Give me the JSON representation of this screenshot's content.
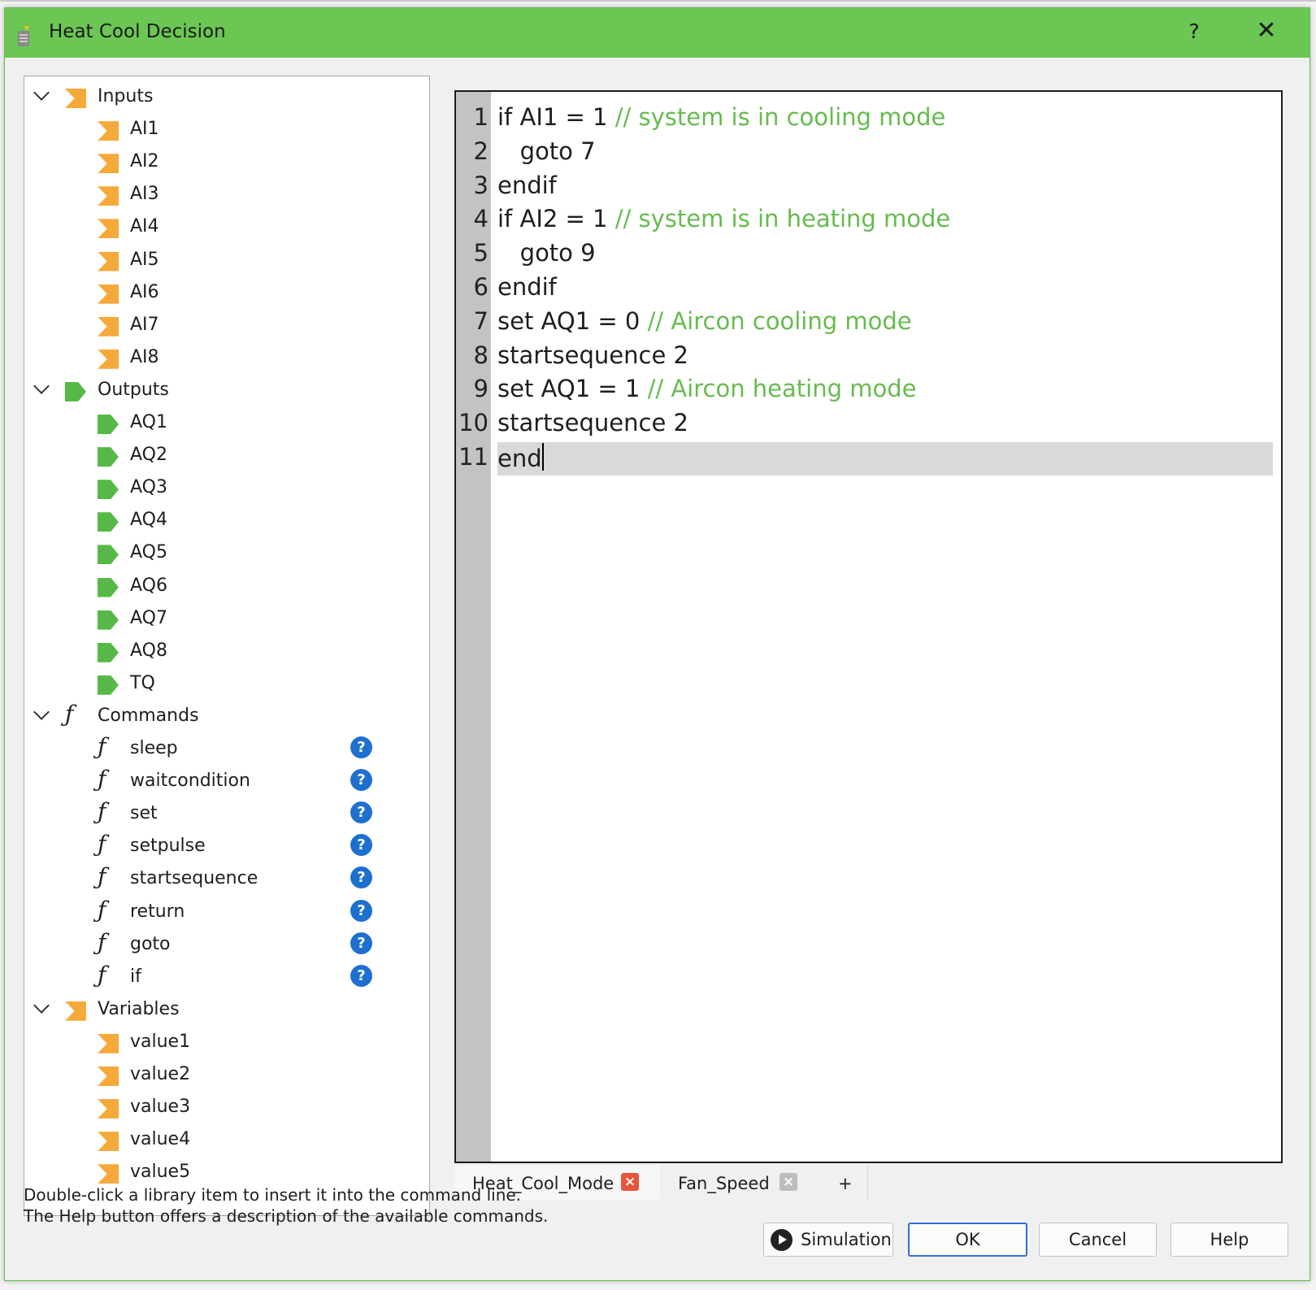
{
  "window": {
    "title": "Heat Cool Decision",
    "help_glyph": "?",
    "close_glyph": "✕"
  },
  "library": {
    "inputs": {
      "label": "Inputs",
      "items": [
        "AI1",
        "AI2",
        "AI3",
        "AI4",
        "AI5",
        "AI6",
        "AI7",
        "AI8"
      ]
    },
    "outputs": {
      "label": "Outputs",
      "items": [
        "AQ1",
        "AQ2",
        "AQ3",
        "AQ4",
        "AQ5",
        "AQ6",
        "AQ7",
        "AQ8",
        "TQ"
      ]
    },
    "commands": {
      "label": "Commands",
      "items": [
        "sleep",
        "waitcondition",
        "set",
        "setpulse",
        "startsequence",
        "return",
        "goto",
        "if"
      ]
    },
    "variables": {
      "label": "Variables",
      "items": [
        "value1",
        "value2",
        "value3",
        "value4",
        "value5"
      ]
    }
  },
  "editor": {
    "lines": [
      {
        "num": "1",
        "code": "if AI1 = 1 ",
        "comment": "// system is in cooling mode"
      },
      {
        "num": "2",
        "code": "   goto 7",
        "comment": ""
      },
      {
        "num": "3",
        "code": "endif",
        "comment": ""
      },
      {
        "num": "4",
        "code": "if AI2 = 1 ",
        "comment": "// system is in heating mode"
      },
      {
        "num": "5",
        "code": "   goto 9",
        "comment": ""
      },
      {
        "num": "6",
        "code": "endif",
        "comment": ""
      },
      {
        "num": "7",
        "code": "set AQ1 = 0 ",
        "comment": "// Aircon cooling mode"
      },
      {
        "num": "8",
        "code": "startsequence 2",
        "comment": ""
      },
      {
        "num": "9",
        "code": "set AQ1 = 1 ",
        "comment": "// Aircon heating mode"
      },
      {
        "num": "10",
        "code": "startsequence 2",
        "comment": ""
      },
      {
        "num": "11",
        "code": "end",
        "comment": ""
      }
    ],
    "current_line": 11
  },
  "tabs": [
    {
      "label": "Heat_Cool_Mode",
      "active": true
    },
    {
      "label": "Fan_Speed",
      "active": false
    }
  ],
  "add_tab_label": "+",
  "hints": {
    "line1": "Double-click a library item to insert it into the command line.",
    "line2": "The Help button offers a description of the available commands."
  },
  "buttons": {
    "simulation": "Simulation",
    "ok": "OK",
    "cancel": "Cancel",
    "help": "Help"
  },
  "colors": {
    "titlebar": "#6bc653",
    "comment": "#66bb4f",
    "input_icon": "#f6a93b",
    "output_icon": "#56b947",
    "help_icon": "#1d6fd0"
  }
}
